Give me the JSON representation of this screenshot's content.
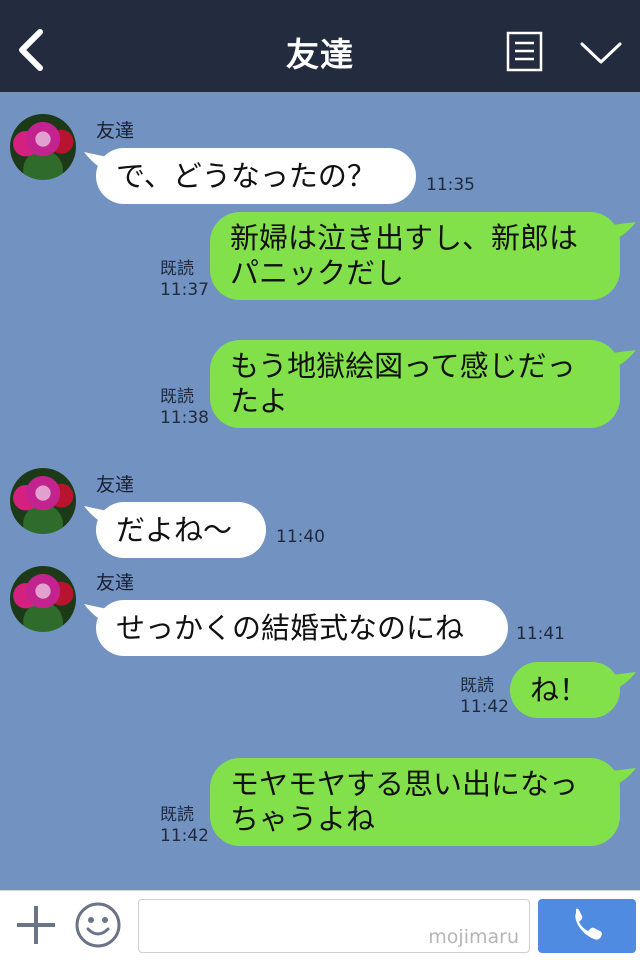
{
  "header": {
    "title": "友達",
    "back_icon": "chevron-left-icon",
    "notes_icon": "notes-icon",
    "collapse_icon": "chevron-down-icon",
    "background": "#232b3f"
  },
  "chat": {
    "background": "#7292c2",
    "incoming_bubble_color": "#ffffff",
    "outgoing_bubble_color": "#82e14a",
    "messages": [
      {
        "direction": "in",
        "sender": "友達",
        "text": "で、どうなったの？",
        "time": "11:35"
      },
      {
        "direction": "out",
        "read": "既読",
        "text_lines": [
          "新婦は泣き出すし、新郎は",
          "パニックだし"
        ],
        "time": "11:37"
      },
      {
        "direction": "out",
        "read": "既読",
        "text_lines": [
          "もう地獄絵図って感じだっ",
          "たよ"
        ],
        "time": "11:38"
      },
      {
        "direction": "in",
        "sender": "友達",
        "text": "だよね〜",
        "time": "11:40"
      },
      {
        "direction": "in",
        "sender": "友達",
        "text": "せっかくの結婚式なのにね",
        "time": "11:41"
      },
      {
        "direction": "out",
        "read": "既読",
        "text": "ね！",
        "time": "11:42"
      },
      {
        "direction": "out",
        "read": "既読",
        "text_lines": [
          "モヤモヤする思い出になっ",
          "ちゃうよね"
        ],
        "time": "11:42"
      }
    ]
  },
  "footer": {
    "plus_icon": "plus-icon",
    "emoji_icon": "emoji-icon",
    "input_value": "",
    "watermark": "mojimaru",
    "call_icon": "phone-icon",
    "call_button_color": "#4f8be0"
  }
}
